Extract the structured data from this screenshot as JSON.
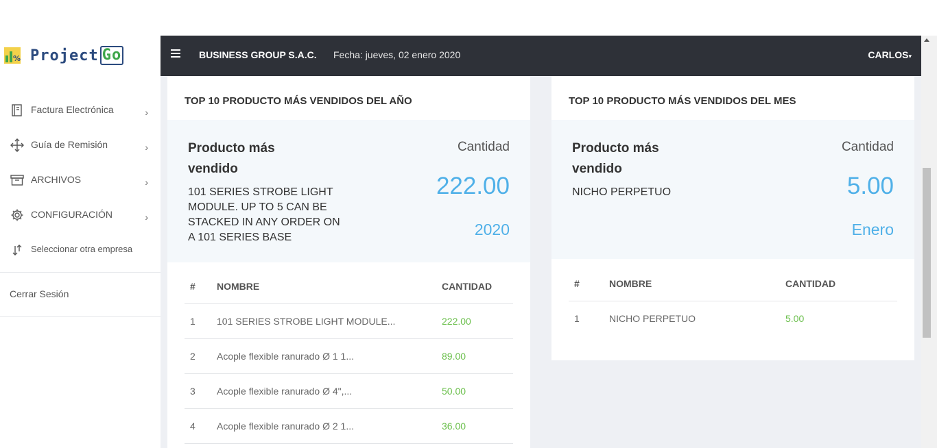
{
  "app": {
    "logo_main": "Project",
    "logo_accent": "Go"
  },
  "sidebar": {
    "items": [
      {
        "label": "Factura Electrónica",
        "icon": "invoice-icon"
      },
      {
        "label": "Guía de Remisión",
        "icon": "move-arrows-icon"
      },
      {
        "label": "ARCHIVOS",
        "icon": "archive-box-icon"
      },
      {
        "label": "CONFIGURACIÓN",
        "icon": "gear-icon"
      },
      {
        "label": "Seleccionar otra empresa",
        "icon": "swap-arrows-icon"
      }
    ],
    "logout": "Cerrar Sesión"
  },
  "header": {
    "company": "BUSINESS GROUP S.A.C.",
    "date": "Fecha: jueves, 02 enero 2020",
    "user": "CARLOS"
  },
  "year_card": {
    "title": "TOP 10 PRODUCTO MÁS VENDIDOS DEL AÑO",
    "summary_label": "Producto más vendido",
    "summary_product": "101 SERIES STROBE LIGHT MODULE. UP TO 5 CAN BE STACKED IN ANY ORDER ON A 101 SERIES BASE",
    "qty_label": "Cantidad",
    "qty": "222.00",
    "period": "2020",
    "columns": [
      "#",
      "NOMBRE",
      "CANTIDAD"
    ],
    "rows": [
      {
        "n": "1",
        "name": "101 SERIES STROBE LIGHT MODULE...",
        "qty": "222.00"
      },
      {
        "n": "2",
        "name": "Acople flexible ranurado Ø 1 1...",
        "qty": "89.00"
      },
      {
        "n": "3",
        "name": "Acople flexible ranurado Ø 4\",...",
        "qty": "50.00"
      },
      {
        "n": "4",
        "name": "Acople flexible ranurado Ø 2 1...",
        "qty": "36.00"
      }
    ]
  },
  "month_card": {
    "title": "TOP 10 PRODUCTO MÁS VENDIDOS DEL MES",
    "summary_label": "Producto más vendido",
    "summary_product": "NICHO PERPETUO",
    "qty_label": "Cantidad",
    "qty": "5.00",
    "period": "Enero",
    "columns": [
      "#",
      "NOMBRE",
      "CANTIDAD"
    ],
    "rows": [
      {
        "n": "1",
        "name": "NICHO PERPETUO",
        "qty": "5.00"
      }
    ]
  }
}
